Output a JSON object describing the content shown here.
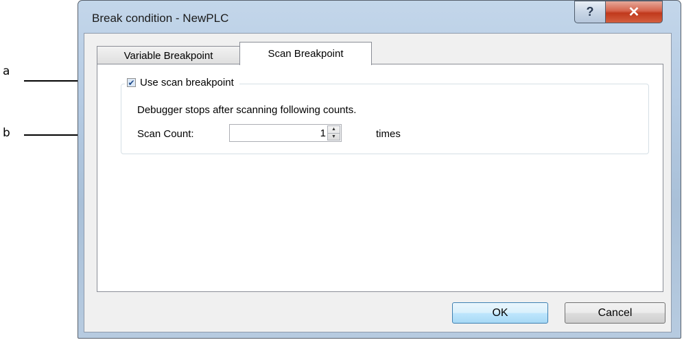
{
  "annotations": {
    "a": "a",
    "b": "b"
  },
  "window": {
    "title": "Break condition - NewPLC",
    "help_glyph": "?",
    "close_glyph": "✕"
  },
  "tabs": [
    {
      "label": "Variable Breakpoint",
      "active": false
    },
    {
      "label": "Scan Breakpoint",
      "active": true
    }
  ],
  "scan_breakpoint": {
    "use_label": "Use scan breakpoint",
    "use_checked": true,
    "description": "Debugger stops after scanning following counts.",
    "scan_count_label": "Scan Count:",
    "scan_count_value": "1",
    "unit": "times"
  },
  "buttons": {
    "ok": "OK",
    "cancel": "Cancel"
  },
  "colors": {
    "ok_border": "#3c7fb1",
    "close_red": "#c0391c",
    "frame": "#b5cbe3"
  }
}
